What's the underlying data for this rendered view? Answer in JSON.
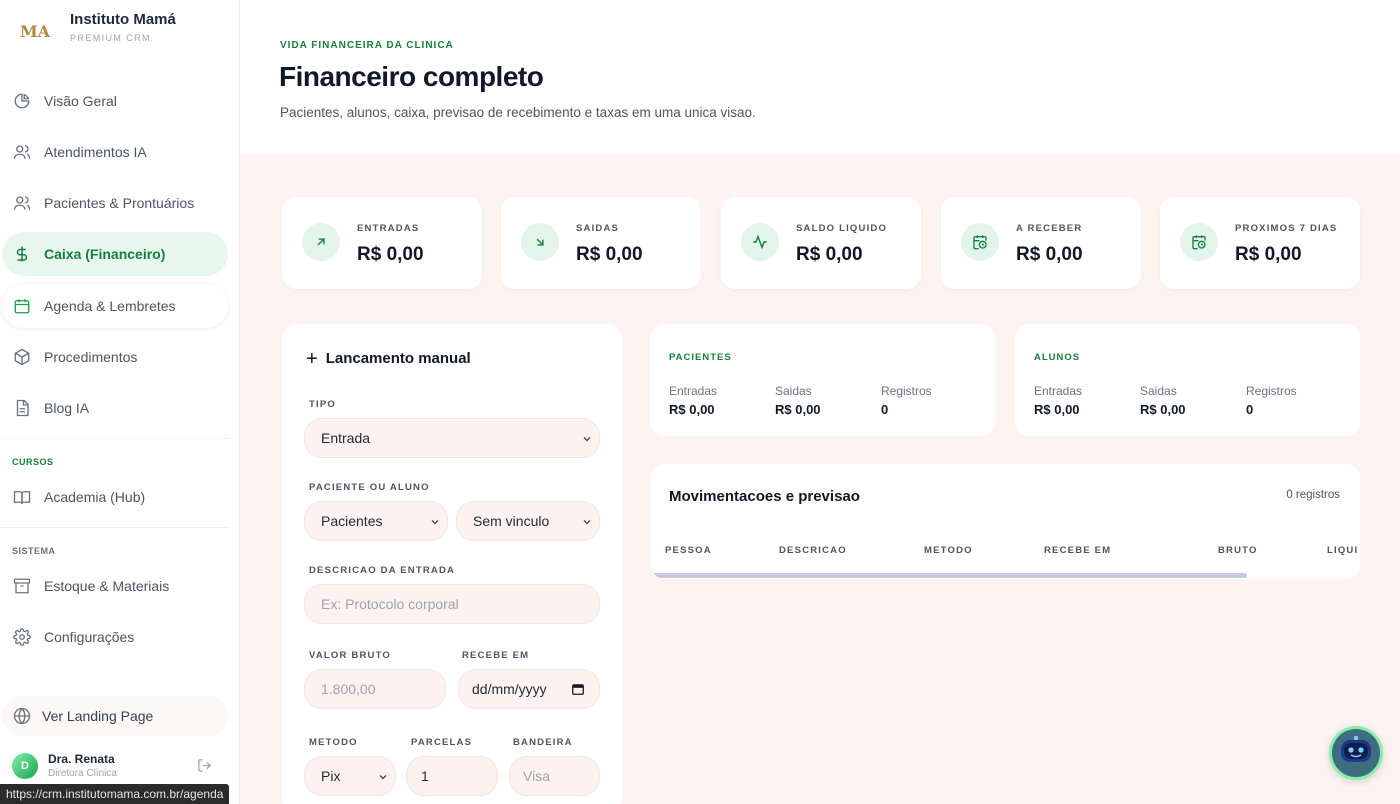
{
  "brand": {
    "logo": "MA",
    "name": "Instituto Mamá",
    "subtitle": "PREMIUM CRM"
  },
  "nav": {
    "main": [
      {
        "label": "Visão Geral",
        "icon": "pie-chart-icon"
      },
      {
        "label": "Atendimentos IA",
        "icon": "users-icon"
      },
      {
        "label": "Pacientes & Prontuários",
        "icon": "users-icon"
      },
      {
        "label": "Caixa (Financeiro)",
        "icon": "dollar-icon",
        "active": true
      },
      {
        "label": "Agenda & Lembretes",
        "icon": "calendar-icon"
      },
      {
        "label": "Procedimentos",
        "icon": "box-icon"
      },
      {
        "label": "Blog IA",
        "icon": "document-icon"
      }
    ],
    "cursos_label": "CURSOS",
    "cursos": [
      {
        "label": "Academia (Hub)",
        "icon": "book-icon"
      }
    ],
    "sistema_label": "SISTEMA",
    "sistema": [
      {
        "label": "Estoque & Materiais",
        "icon": "archive-icon"
      },
      {
        "label": "Configurações",
        "icon": "gear-icon"
      }
    ],
    "landing": "Ver Landing Page"
  },
  "user": {
    "initial": "D",
    "name": "Dra. Renata",
    "role": "Diretora Clínica"
  },
  "statusbar": "https://crm.institutomama.com.br/agenda",
  "header": {
    "eyebrow": "VIDA FINANCEIRA DA CLINICA",
    "title": "Financeiro completo",
    "description": "Pacientes, alunos, caixa, previsao de recebimento e taxas em uma unica visao."
  },
  "kpis": [
    {
      "label": "ENTRADAS",
      "value": "R$ 0,00",
      "icon": "arrow-up-right-icon"
    },
    {
      "label": "SAIDAS",
      "value": "R$ 0,00",
      "icon": "arrow-down-right-icon"
    },
    {
      "label": "SALDO LIQUIDO",
      "value": "R$ 0,00",
      "icon": "activity-icon"
    },
    {
      "label": "A RECEBER",
      "value": "R$ 0,00",
      "icon": "calendar-clock-icon"
    },
    {
      "label": "PROXIMOS 7 DIAS",
      "value": "R$ 0,00",
      "icon": "calendar-clock-icon"
    }
  ],
  "form": {
    "title": "Lancamento manual",
    "tipo_label": "TIPO",
    "tipo_value": "Entrada",
    "vinculo_label": "PACIENTE OU ALUNO",
    "grupo_value": "Pacientes",
    "vinculo_value": "Sem vinculo",
    "descricao_label": "DESCRICAO DA ENTRADA",
    "descricao_placeholder": "Ex: Protocolo corporal",
    "valor_label": "VALOR BRUTO",
    "valor_placeholder": "1.800,00",
    "recebe_label": "RECEBE EM",
    "recebe_placeholder": "dd/mm/yyyy",
    "metodo_label": "METODO",
    "metodo_value": "Pix",
    "parcelas_label": "PARCELAS",
    "parcelas_value": "1",
    "bandeira_label": "BANDEIRA",
    "bandeira_placeholder": "Visa"
  },
  "summaries": [
    {
      "title": "PACIENTES",
      "entradas_label": "Entradas",
      "entradas": "R$ 0,00",
      "saidas_label": "Saidas",
      "saidas": "R$ 0,00",
      "registros_label": "Registros",
      "registros": "0"
    },
    {
      "title": "ALUNOS",
      "entradas_label": "Entradas",
      "entradas": "R$ 0,00",
      "saidas_label": "Saidas",
      "saidas": "R$ 0,00",
      "registros_label": "Registros",
      "registros": "0"
    }
  ],
  "table": {
    "title": "Movimentacoes e previsao",
    "count": "0 registros",
    "columns": [
      "PESSOA",
      "DESCRICAO",
      "METODO",
      "RECEBE EM",
      "BRUTO",
      "LIQUI"
    ]
  },
  "colors": {
    "accent": "#15803d",
    "accent_bg": "#e8f7ee",
    "page_bg": "#fdf4f1",
    "field_bg": "#fdf2ef"
  }
}
